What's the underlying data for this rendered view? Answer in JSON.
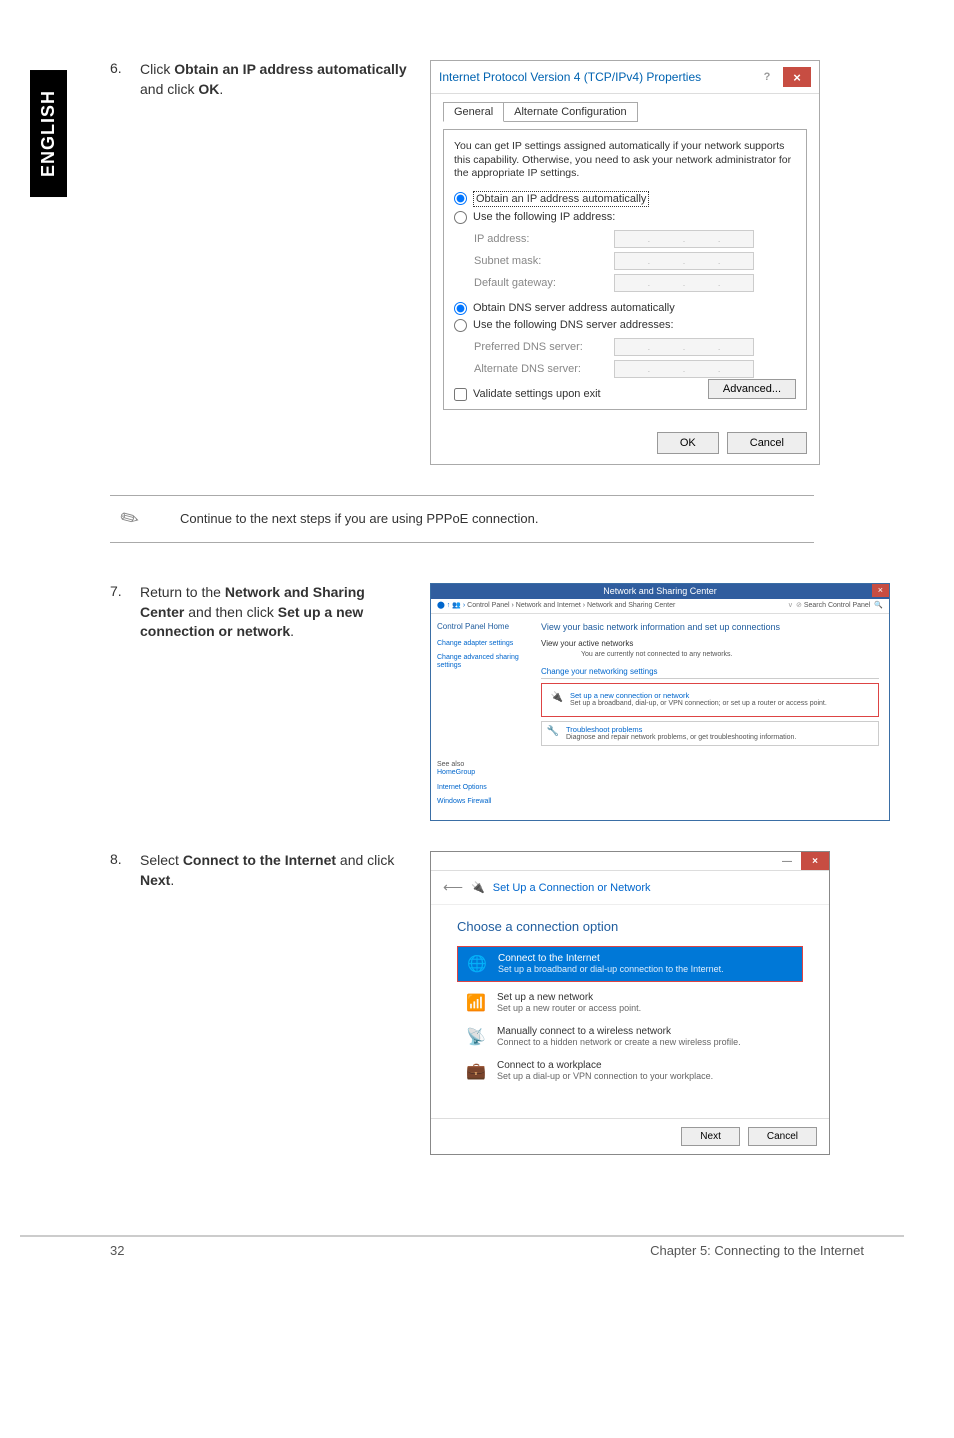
{
  "tab_label": "ENGLISH",
  "step6": {
    "num": "6.",
    "text_prefix": "Click ",
    "bold1": "Obtain an IP address automatically",
    "text_mid": " and click ",
    "bold2": "OK",
    "text_suffix": "."
  },
  "ipv4": {
    "title": "Internet Protocol Version 4 (TCP/IPv4) Properties",
    "help": "?",
    "close": "×",
    "tabs": {
      "general": "General",
      "alt": "Alternate Configuration"
    },
    "info": "You can get IP settings assigned automatically if your network supports this capability. Otherwise, you need to ask your network administrator for the appropriate IP settings.",
    "radio_auto_ip": "Obtain an IP address automatically",
    "radio_use_ip": "Use the following IP address:",
    "ip_address": "IP address:",
    "subnet": "Subnet mask:",
    "gateway": "Default gateway:",
    "radio_auto_dns": "Obtain DNS server address automatically",
    "radio_use_dns": "Use the following DNS server addresses:",
    "pref_dns": "Preferred DNS server:",
    "alt_dns": "Alternate DNS server:",
    "validate": "Validate settings upon exit",
    "advanced": "Advanced...",
    "ok": "OK",
    "cancel": "Cancel"
  },
  "note": {
    "text": "Continue to the next steps if you are using PPPoE connection."
  },
  "step7": {
    "num": "7.",
    "text_prefix": "Return to the ",
    "bold1": "Network and Sharing Center",
    "text_mid": " and then click ",
    "bold2": "Set up a new connection or network",
    "text_suffix": "."
  },
  "nsc": {
    "title": "Network and Sharing Center",
    "breadcrumb": "Control Panel  ›  Network and Internet  ›  Network and Sharing Center",
    "search": "Search Control Panel",
    "sidebar": {
      "home": "Control Panel Home",
      "adapter": "Change adapter settings",
      "advanced": "Change advanced sharing settings",
      "see_also": "See also",
      "homegroup": "HomeGroup",
      "inet_opts": "Internet Options",
      "firewall": "Windows Firewall"
    },
    "heading": "View your basic network information and set up connections",
    "active_label": "View your active networks",
    "active_text": "You are currently not connected to any networks.",
    "change_heading": "Change your networking settings",
    "setup_title": "Set up a new connection or network",
    "setup_desc": "Set up a broadband, dial-up, or VPN connection; or set up a router or access point.",
    "trouble_title": "Troubleshoot problems",
    "trouble_desc": "Diagnose and repair network problems, or get troubleshooting information."
  },
  "step8": {
    "num": "8.",
    "text_prefix": "Select ",
    "bold1": "Connect to the Internet",
    "text_mid": " and click ",
    "bold2": "Next",
    "text_suffix": "."
  },
  "wizard": {
    "header": "Set Up a Connection or Network",
    "heading": "Choose a connection option",
    "opt1_title": "Connect to the Internet",
    "opt1_desc": "Set up a broadband or dial-up connection to the Internet.",
    "opt2_title": "Set up a new network",
    "opt2_desc": "Set up a new router or access point.",
    "opt3_title": "Manually connect to a wireless network",
    "opt3_desc": "Connect to a hidden network or create a new wireless profile.",
    "opt4_title": "Connect to a workplace",
    "opt4_desc": "Set up a dial-up or VPN connection to your workplace.",
    "next": "Next",
    "cancel": "Cancel"
  },
  "footer": {
    "pagenum": "32",
    "chapter": "Chapter 5: Connecting to the Internet"
  }
}
